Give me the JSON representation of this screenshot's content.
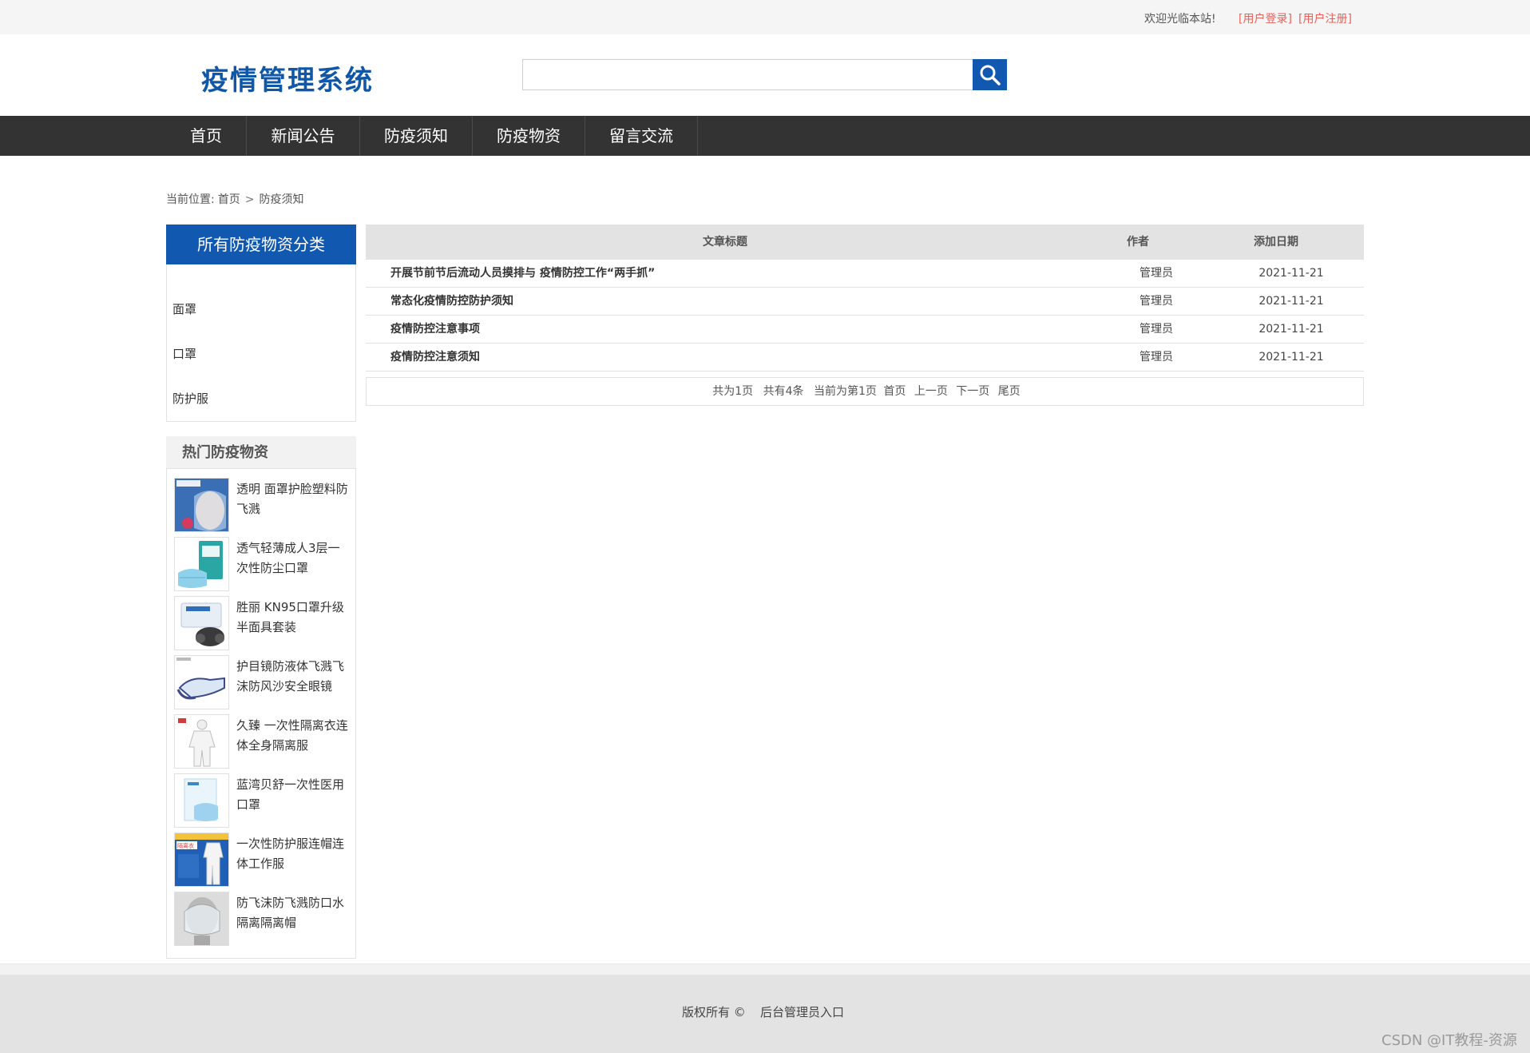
{
  "topbar": {
    "welcome": "欢迎光临本站!",
    "login": "[用户登录]",
    "register": "[用户注册]"
  },
  "header": {
    "logo": "疫情管理系统",
    "search_placeholder": ""
  },
  "nav": {
    "items": [
      "首页",
      "新闻公告",
      "防疫须知",
      "防疫物资",
      "留言交流"
    ]
  },
  "breadcrumb": {
    "prefix": "当前位置:",
    "home": "首页",
    "separator": ">",
    "current": "防疫须知"
  },
  "sidebar": {
    "category_title": "所有防疫物资分类",
    "categories": [
      "面罩",
      "口罩",
      "防护服"
    ],
    "hot_title": "热门防疫物资",
    "hot_items": [
      {
        "name": "透明 面罩护脸塑料防飞溅",
        "thumb": "face-shield"
      },
      {
        "name": "透气轻薄成人3层一次性防尘口罩",
        "thumb": "mask-pack"
      },
      {
        "name": "胜丽 KN95口罩升级半面具套装",
        "thumb": "respirator"
      },
      {
        "name": "护目镜防液体飞溅飞沫防风沙安全眼镜",
        "thumb": "goggles"
      },
      {
        "name": "久臻 一次性隔离衣连体全身隔离服",
        "thumb": "protective-suit"
      },
      {
        "name": "蓝湾贝舒一次性医用口罩",
        "thumb": "medical-mask"
      },
      {
        "name": "一次性防护服连帽连体工作服",
        "thumb": "hooded-suit"
      },
      {
        "name": "防飞沫防飞溅防口水隔离隔离帽",
        "thumb": "isolation-hood"
      }
    ]
  },
  "table": {
    "headers": {
      "title": "文章标题",
      "author": "作者",
      "date": "添加日期"
    },
    "rows": [
      {
        "title": "开展节前节后流动人员摸排与 疫情防控工作“两手抓”",
        "author": "管理员",
        "date": "2021-11-21"
      },
      {
        "title": "常态化疫情防控防护须知",
        "author": "管理员",
        "date": "2021-11-21"
      },
      {
        "title": "疫情防控注意事项",
        "author": "管理员",
        "date": "2021-11-21"
      },
      {
        "title": "疫情防控注意须知",
        "author": "管理员",
        "date": "2021-11-21"
      }
    ]
  },
  "pager": {
    "total_pages": "共为1页",
    "total_items": "共有4条",
    "current_page": "当前为第1页",
    "first": "首页",
    "prev": "上一页",
    "next": "下一页",
    "last": "尾页"
  },
  "footer": {
    "copyright": "版权所有  ©",
    "admin_link": "后台管理员入口",
    "watermark": "CSDN @IT教程-资源"
  },
  "colors": {
    "brand_blue": "#1058b0",
    "nav_bg": "#333333",
    "link_red": "#e8615a"
  }
}
